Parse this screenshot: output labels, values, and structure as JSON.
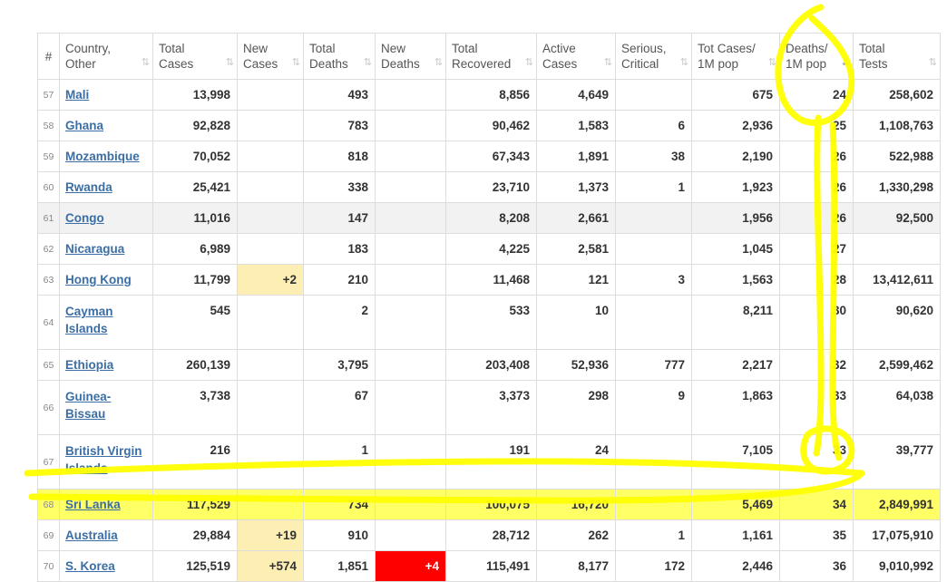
{
  "headers": {
    "num": "#",
    "country_l1": "Country,",
    "country_l2": "Other",
    "total_cases_l1": "Total",
    "total_cases_l2": "Cases",
    "new_cases_l1": "New",
    "new_cases_l2": "Cases",
    "total_deaths_l1": "Total",
    "total_deaths_l2": "Deaths",
    "new_deaths_l1": "New",
    "new_deaths_l2": "Deaths",
    "total_recovered_l1": "Total",
    "total_recovered_l2": "Recovered",
    "active_cases_l1": "Active",
    "active_cases_l2": "Cases",
    "serious_l1": "Serious,",
    "serious_l2": "Critical",
    "tot_cases_1m_l1": "Tot Cases/",
    "tot_cases_1m_l2": "1M pop",
    "deaths_1m_l1": "Deaths/",
    "deaths_1m_l2": "1M pop",
    "total_tests_l1": "Total",
    "total_tests_l2": "Tests",
    "sort_icon": "⇅",
    "sort_active_icon": "⇊"
  },
  "rows": [
    {
      "num": "57",
      "country": "Mali",
      "total_cases": "13,998",
      "new_cases": "",
      "total_deaths": "493",
      "new_deaths": "",
      "total_recovered": "8,856",
      "active_cases": "4,649",
      "serious": "",
      "tot_cases_1m": "675",
      "deaths_1m": "24",
      "total_tests": "258,602"
    },
    {
      "num": "58",
      "country": "Ghana",
      "total_cases": "92,828",
      "new_cases": "",
      "total_deaths": "783",
      "new_deaths": "",
      "total_recovered": "90,462",
      "active_cases": "1,583",
      "serious": "6",
      "tot_cases_1m": "2,936",
      "deaths_1m": "25",
      "total_tests": "1,108,763"
    },
    {
      "num": "59",
      "country": "Mozambique",
      "total_cases": "70,052",
      "new_cases": "",
      "total_deaths": "818",
      "new_deaths": "",
      "total_recovered": "67,343",
      "active_cases": "1,891",
      "serious": "38",
      "tot_cases_1m": "2,190",
      "deaths_1m": "26",
      "total_tests": "522,988"
    },
    {
      "num": "60",
      "country": "Rwanda",
      "total_cases": "25,421",
      "new_cases": "",
      "total_deaths": "338",
      "new_deaths": "",
      "total_recovered": "23,710",
      "active_cases": "1,373",
      "serious": "1",
      "tot_cases_1m": "1,923",
      "deaths_1m": "26",
      "total_tests": "1,330,298"
    },
    {
      "num": "61",
      "country": "Congo",
      "total_cases": "11,016",
      "new_cases": "",
      "total_deaths": "147",
      "new_deaths": "",
      "total_recovered": "8,208",
      "active_cases": "2,661",
      "serious": "",
      "tot_cases_1m": "1,956",
      "deaths_1m": "26",
      "total_tests": "92,500"
    },
    {
      "num": "62",
      "country": "Nicaragua",
      "total_cases": "6,989",
      "new_cases": "",
      "total_deaths": "183",
      "new_deaths": "",
      "total_recovered": "4,225",
      "active_cases": "2,581",
      "serious": "",
      "tot_cases_1m": "1,045",
      "deaths_1m": "27",
      "total_tests": ""
    },
    {
      "num": "63",
      "country": "Hong Kong",
      "total_cases": "11,799",
      "new_cases": "+2",
      "total_deaths": "210",
      "new_deaths": "",
      "total_recovered": "11,468",
      "active_cases": "121",
      "serious": "3",
      "tot_cases_1m": "1,563",
      "deaths_1m": "28",
      "total_tests": "13,412,611"
    },
    {
      "num": "64",
      "country_l1": "Cayman",
      "country_l2": "Islands",
      "total_cases": "545",
      "new_cases": "",
      "total_deaths": "2",
      "new_deaths": "",
      "total_recovered": "533",
      "active_cases": "10",
      "serious": "",
      "tot_cases_1m": "8,211",
      "deaths_1m": "30",
      "total_tests": "90,620"
    },
    {
      "num": "65",
      "country": "Ethiopia",
      "total_cases": "260,139",
      "new_cases": "",
      "total_deaths": "3,795",
      "new_deaths": "",
      "total_recovered": "203,408",
      "active_cases": "52,936",
      "serious": "777",
      "tot_cases_1m": "2,217",
      "deaths_1m": "32",
      "total_tests": "2,599,462"
    },
    {
      "num": "66",
      "country_l1": "Guinea-",
      "country_l2": "Bissau",
      "total_cases": "3,738",
      "new_cases": "",
      "total_deaths": "67",
      "new_deaths": "",
      "total_recovered": "3,373",
      "active_cases": "298",
      "serious": "9",
      "tot_cases_1m": "1,863",
      "deaths_1m": "33",
      "total_tests": "64,038"
    },
    {
      "num": "67",
      "country_l1": "British Virgin",
      "country_l2": "Islands",
      "total_cases": "216",
      "new_cases": "",
      "total_deaths": "1",
      "new_deaths": "",
      "total_recovered": "191",
      "active_cases": "24",
      "serious": "",
      "tot_cases_1m": "7,105",
      "deaths_1m": "33",
      "total_tests": "39,777"
    },
    {
      "num": "68",
      "country": "Sri Lanka",
      "total_cases": "117,529",
      "new_cases": "",
      "total_deaths": "734",
      "new_deaths": "",
      "total_recovered": "100,075",
      "active_cases": "16,720",
      "serious": "",
      "tot_cases_1m": "5,469",
      "deaths_1m": "34",
      "total_tests": "2,849,991"
    },
    {
      "num": "69",
      "country": "Australia",
      "total_cases": "29,884",
      "new_cases": "+19",
      "total_deaths": "910",
      "new_deaths": "",
      "total_recovered": "28,712",
      "active_cases": "262",
      "serious": "1",
      "tot_cases_1m": "1,161",
      "deaths_1m": "35",
      "total_tests": "17,075,910"
    },
    {
      "num": "70",
      "country": "S. Korea",
      "total_cases": "125,519",
      "new_cases": "+574",
      "total_deaths": "1,851",
      "new_deaths": "+4",
      "total_recovered": "115,491",
      "active_cases": "8,177",
      "serious": "172",
      "tot_cases_1m": "2,446",
      "deaths_1m": "36",
      "total_tests": "9,010,992"
    }
  ],
  "colors": {
    "highlighter": "#ffff00",
    "new_cases_bg": "#fdeeb3",
    "new_deaths_bg": "#ff0000",
    "link": "#3b6ea5"
  }
}
